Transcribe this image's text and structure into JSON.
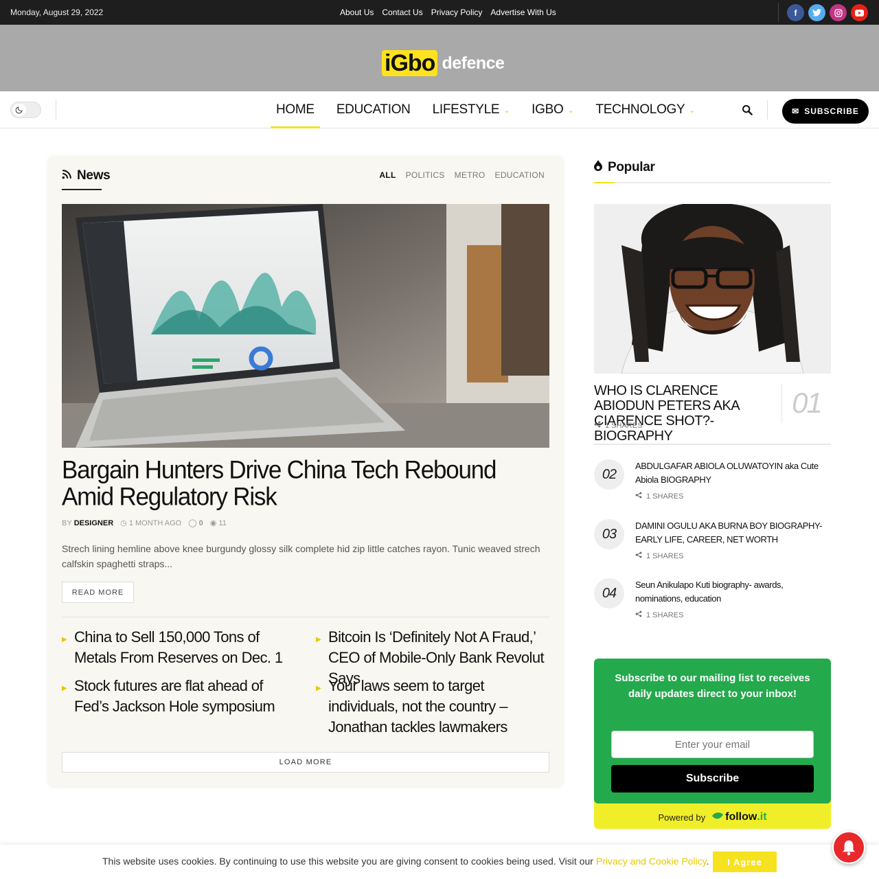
{
  "topbar": {
    "date": "Monday, August 29, 2022",
    "links": [
      "About Us",
      "Contact Us",
      "Privacy Policy",
      "Advertise With Us"
    ],
    "socials": [
      {
        "name": "facebook-icon",
        "glyph": "f",
        "color": "#3b5998"
      },
      {
        "name": "twitter-icon",
        "glyph": "t",
        "color": "#55acee"
      },
      {
        "name": "instagram-icon",
        "glyph": "◎",
        "color": "#c13584"
      },
      {
        "name": "youtube-icon",
        "glyph": "▶",
        "color": "#e62117"
      }
    ]
  },
  "logo": {
    "part1": "iGbo",
    "part2": "defence"
  },
  "nav": {
    "items": [
      {
        "label": "Home",
        "active": true,
        "dropdown": false
      },
      {
        "label": "Education",
        "active": false,
        "dropdown": false
      },
      {
        "label": "Lifestyle",
        "active": false,
        "dropdown": true
      },
      {
        "label": "Igbo",
        "active": false,
        "dropdown": true
      },
      {
        "label": "Technology",
        "active": false,
        "dropdown": true
      }
    ],
    "subscribe_label": "SUBSCRIBE"
  },
  "news": {
    "title": "News",
    "filters": [
      "ALL",
      "POLITICS",
      "METRO",
      "EDUCATION"
    ],
    "featured": {
      "title": "Bargain Hunters Drive China Tech Rebound Amid Regulatory Risk",
      "by": "BY",
      "author": "DESIGNER",
      "time": "1 MONTH AGO",
      "comments": "0",
      "views": "11",
      "excerpt": "Strech lining hemline above knee burgundy glossy silk complete hid zip little catches rayon. Tunic weaved strech calfskin spaghetti straps...",
      "read_more": "READ MORE"
    },
    "list": [
      "China to Sell 150,000 Tons of Metals From Reserves on Dec. 1",
      "Bitcoin Is ‘Definitely Not A Fraud,’ CEO of Mobile-Only Bank Revolut Says",
      "Stock futures are flat ahead of Fed’s Jackson Hole symposium",
      "Your laws seem to target individuals, not the country – Jonathan tackles lawmakers"
    ],
    "load_more": "LOAD MORE"
  },
  "popular": {
    "title": "Popular",
    "items": [
      {
        "num": "01",
        "title": "Who is Clarence Abiodun Peters aka Ciarence Shot?- Biography",
        "shares": "1 SHARES"
      },
      {
        "num": "02",
        "title": "ABDULGAFAR ABIOLA OLUWATOYIN aka Cute Abiola BIOGRAPHY",
        "shares": "1 SHARES"
      },
      {
        "num": "03",
        "title": "DAMINI OGULU AKA BURNA BOY BIOGRAPHY- EARLY LIFE, CAREER, NET WORTH",
        "shares": "1 SHARES"
      },
      {
        "num": "04",
        "title": "Seun Anikulapo Kuti biography- awards, nominations, education",
        "shares": "1 SHARES"
      }
    ]
  },
  "subscribe_widget": {
    "message": "Subscribe to our mailing list to receives daily updates direct to your inbox!",
    "email_placeholder": "Enter your email",
    "button": "Subscribe",
    "powered_by": "Powered by",
    "brand_main": "follow",
    "brand_suffix": ".it"
  },
  "cookie": {
    "text": "This website uses cookies. By continuing to use this website you are giving consent to cookies being used. Visit our ",
    "link": "Privacy and Cookie Policy",
    "end": ".",
    "agree": "I Agree"
  },
  "colors": {
    "accent": "#f6e21f",
    "topbar": "#1e1e1e",
    "header": "#a9a9a9",
    "widget_green": "#24a94c"
  }
}
